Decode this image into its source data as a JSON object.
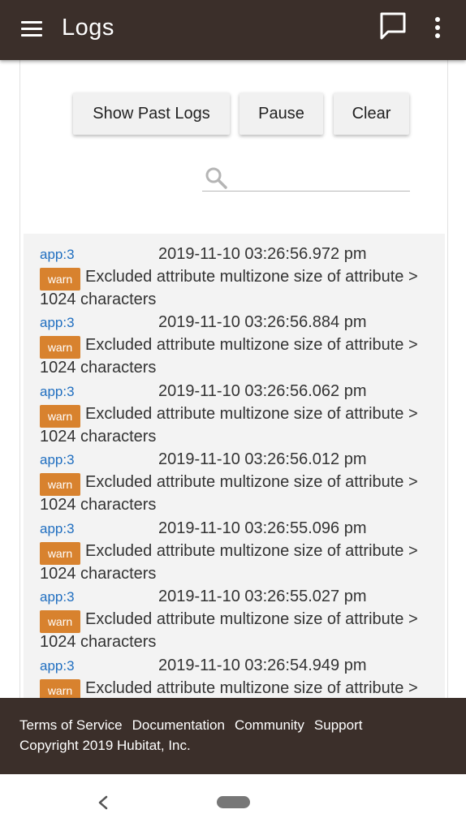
{
  "header": {
    "title": "Logs",
    "menu_icon": "hamburger-menu-icon",
    "chat_icon": "chat-bubble-icon",
    "more_icon": "more-vertical-icon",
    "background_color": "#3b2f2a"
  },
  "toolbar": {
    "show_past_logs_label": "Show Past Logs",
    "pause_label": "Pause",
    "clear_label": "Clear"
  },
  "search": {
    "value": "",
    "placeholder": "",
    "icon": "search-icon"
  },
  "logs": [
    {
      "source": "app:3",
      "timestamp": "2019-11-10 03:26:56.972 pm",
      "level": "warn",
      "message": "Excluded attribute multizone size of attribute >",
      "message_cont": "1024 characters"
    },
    {
      "source": "app:3",
      "timestamp": "2019-11-10 03:26:56.884 pm",
      "level": "warn",
      "message": "Excluded attribute multizone size of attribute >",
      "message_cont": "1024 characters"
    },
    {
      "source": "app:3",
      "timestamp": "2019-11-10 03:26:56.062 pm",
      "level": "warn",
      "message": "Excluded attribute multizone size of attribute >",
      "message_cont": "1024 characters"
    },
    {
      "source": "app:3",
      "timestamp": "2019-11-10 03:26:56.012 pm",
      "level": "warn",
      "message": "Excluded attribute multizone size of attribute >",
      "message_cont": "1024 characters"
    },
    {
      "source": "app:3",
      "timestamp": "2019-11-10 03:26:55.096 pm",
      "level": "warn",
      "message": "Excluded attribute multizone size of attribute >",
      "message_cont": "1024 characters"
    },
    {
      "source": "app:3",
      "timestamp": "2019-11-10 03:26:55.027 pm",
      "level": "warn",
      "message": "Excluded attribute multizone size of attribute >",
      "message_cont": "1024 characters"
    },
    {
      "source": "app:3",
      "timestamp": "2019-11-10 03:26:54.949 pm",
      "level": "warn",
      "message": "Excluded attribute multizone size of attribute >",
      "message_cont": ""
    }
  ],
  "colors": {
    "warn_badge": "#d8822e",
    "source_link": "#1f6ec0",
    "log_panel_bg": "#f3f3f3"
  },
  "footer": {
    "links": [
      "Terms of Service",
      "Documentation",
      "Community",
      "Support"
    ],
    "copyright": "Copyright 2019 Hubitat, Inc."
  },
  "system_nav": {
    "back_icon": "back-chevron-icon",
    "home_icon": "home-pill-icon"
  }
}
